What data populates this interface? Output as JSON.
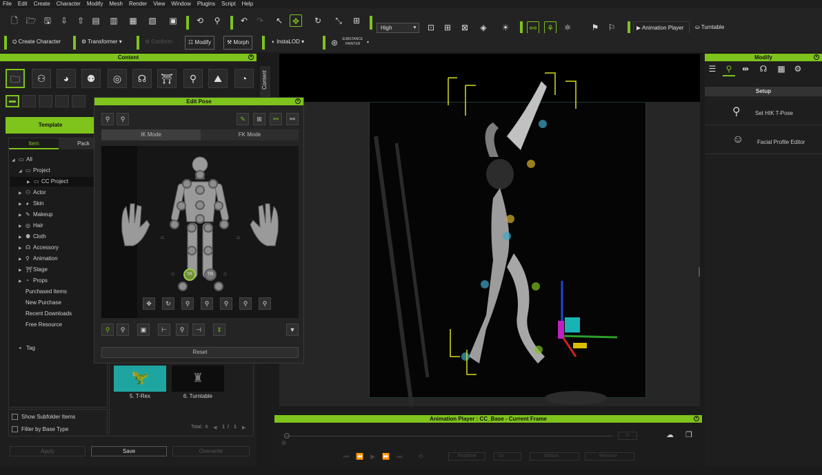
{
  "menu": [
    "File",
    "Edit",
    "Create",
    "Character",
    "Modify",
    "Mesh",
    "Render",
    "View",
    "Window",
    "Plugins",
    "Script",
    "Help"
  ],
  "toolbar": {
    "quality": "High",
    "animation_player": "Animation Player",
    "turntable": "Turntable"
  },
  "toolbar2": {
    "create_character": "Create Character",
    "transformer": "Transformer",
    "conform": "Conform",
    "modify": "Modify",
    "morph": "Morph",
    "instalod": "InstaLOD",
    "substance_line1": "SUBSTANCE",
    "substance_line2": "PAINTER"
  },
  "content": {
    "title": "Content",
    "side_tab": "Content",
    "template_tab": "Template",
    "item_tab": "Item",
    "pack_tab": "Pack",
    "tree": [
      {
        "label": "All"
      },
      {
        "label": "Project"
      },
      {
        "label": "CC Project"
      },
      {
        "label": "Actor"
      },
      {
        "label": "Skin"
      },
      {
        "label": "Makeup"
      },
      {
        "label": "Hair"
      },
      {
        "label": "Cloth"
      },
      {
        "label": "Accessory"
      },
      {
        "label": "Animation"
      },
      {
        "label": "Stage"
      },
      {
        "label": "Props"
      },
      {
        "label": "Purchased Items"
      },
      {
        "label": "New Purchase"
      },
      {
        "label": "Recent Downloads"
      },
      {
        "label": "Free Resource"
      },
      {
        "label": "Tag"
      }
    ],
    "thumbs": [
      {
        "label": "5. T-Rex"
      },
      {
        "label": "6. Turntable"
      }
    ],
    "show_subfolder": "Show Subfolder Items",
    "filter_base": "Filter by Base Type",
    "total": "Total : 6",
    "page_current": "1",
    "page_total": "1",
    "apply": "Apply",
    "save": "Save",
    "overwrite": "Overwrite"
  },
  "edit_pose": {
    "title": "Edit Pose",
    "ik_mode": "IK Mode",
    "fk_mode": "FK Mode",
    "tr1": "TR",
    "tr2": "TR",
    "reset": "Reset"
  },
  "modify": {
    "title": "Modify",
    "setup": "Setup",
    "set_hik": "Set HIK T-Pose",
    "facial": "Facial Profile Editor"
  },
  "anim_player": {
    "title": "Animation Player : CC_Base - Current Frame",
    "frame": "0",
    "realtime": "Realtime",
    "speed": "1x",
    "motion": "Motion",
    "remove": "Remove"
  },
  "colors": {
    "accent": "#7fc31d"
  }
}
